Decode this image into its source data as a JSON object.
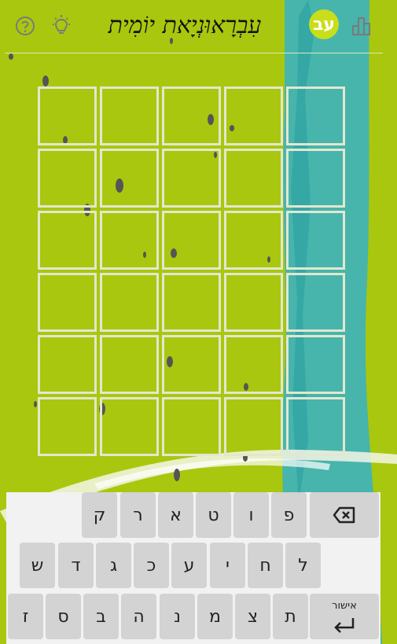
{
  "app": {
    "title": "עִבְרָאוּנְיָאת יוֹמִית",
    "logo_text": "עב"
  },
  "grid": {
    "rows": 6,
    "cols": 5
  },
  "keyboard": {
    "row1": [
      "ק",
      "ר",
      "א",
      "ט",
      "ו",
      "פ"
    ],
    "row2": [
      "ש",
      "ד",
      "ג",
      "כ",
      "ע",
      "י",
      "ח",
      "ל"
    ],
    "row3": [
      "ז",
      "ס",
      "ב",
      "ה",
      "נ",
      "מ",
      "צ",
      "ת"
    ],
    "enter_label": "אישור"
  },
  "colors": {
    "background": "#a9c70e",
    "stripe": "#3fb3b8",
    "cell_border": "#e3e7d0"
  }
}
